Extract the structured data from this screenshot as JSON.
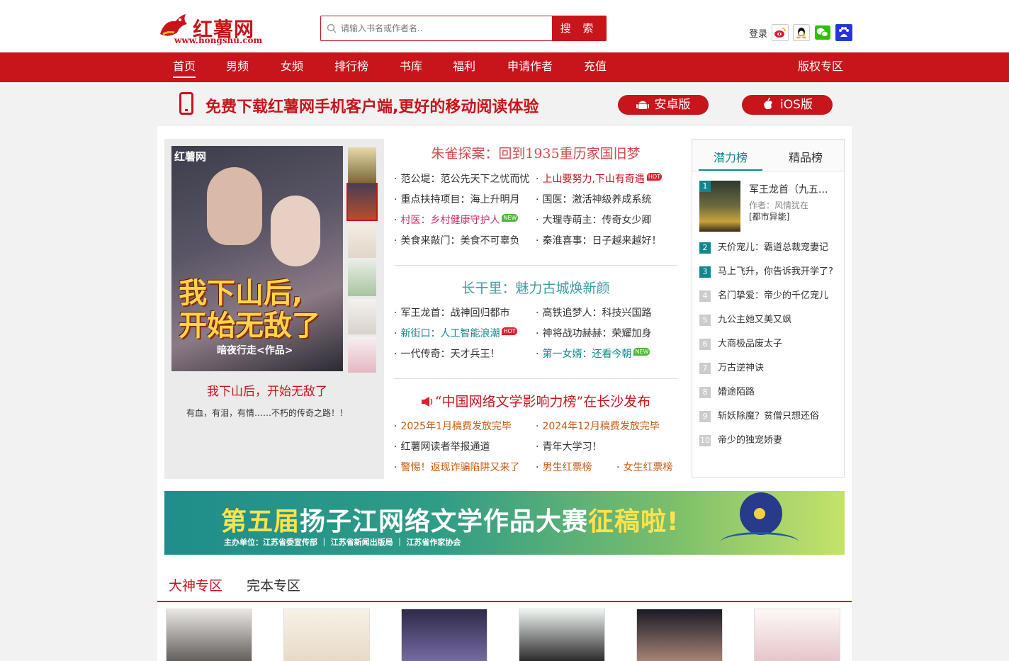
{
  "header": {
    "logo_name": "红薯网",
    "logo_url": "www.hongshu.com",
    "search_placeholder": "请输入书名或作者名..",
    "search_button": "搜 索",
    "login": "登录"
  },
  "nav": {
    "items": [
      "首页",
      "男频",
      "女频",
      "排行榜",
      "书库",
      "福利",
      "申请作者",
      "充值"
    ],
    "right": "版权专区"
  },
  "app_banner": {
    "message": "免费下载红薯网手机客户端,更好的移动阅读体验",
    "android": "安卓版",
    "ios": "iOS版"
  },
  "feature": {
    "cover_tag": "红薯网",
    "cover_title_line1": "我下山后,",
    "cover_title_line2": "开始无敌了",
    "cover_author": "暗夜行走<作品>",
    "title": "我下山后，开始无敌了",
    "desc": "有血，有泪，有情……不朽的传奇之路！！"
  },
  "section1": {
    "heading": "朱雀探案：回到1935重历家国旧梦",
    "items": [
      {
        "text": "范公堤：范公先天下之忧而忧",
        "style": ""
      },
      {
        "text": "上山要努力,下山有奇遇",
        "style": "red",
        "badge": "HOT"
      },
      {
        "text": "重点扶持项目：海上升明月",
        "style": ""
      },
      {
        "text": "国医：激活神级养成系统",
        "style": ""
      },
      {
        "text": "村医：乡村健康守护人",
        "style": "pink",
        "badge": "NEW"
      },
      {
        "text": "大理寺萌主：传奇女少卿",
        "style": ""
      },
      {
        "text": "美食来敲门：美食不可辜负",
        "style": ""
      },
      {
        "text": "秦淮喜事：日子越来越好！",
        "style": ""
      }
    ]
  },
  "section2": {
    "heading": "长干里：魅力古城焕新颜",
    "items": [
      {
        "text": "军王龙首：战神回归都市",
        "style": ""
      },
      {
        "text": "高铁追梦人：科技兴国路",
        "style": ""
      },
      {
        "text": "新街口：人工智能浪潮",
        "style": "teal",
        "badge": "HOT"
      },
      {
        "text": "神将战功赫赫：荣耀加身",
        "style": ""
      },
      {
        "text": "一代传奇：天才兵王！",
        "style": ""
      },
      {
        "text": "第一女婿：还看今朝",
        "style": "teal",
        "badge": "NEW"
      }
    ]
  },
  "section3": {
    "heading": "“中国网络文学影响力榜”在长沙发布",
    "items": [
      {
        "text": "2025年1月稿费发放完毕",
        "style": "orange"
      },
      {
        "text": "2024年12月稿费发放完毕",
        "style": "orange"
      },
      {
        "text": "红薯网读者举报通道",
        "style": ""
      },
      {
        "text": "青年大学习！",
        "style": ""
      },
      {
        "text": "警惕！返现诈骗陷阱又来了",
        "style": "orange"
      },
      {
        "text": "男生红票榜",
        "style": "orange"
      },
      {
        "text": "女生红票榜",
        "style": "orange"
      }
    ]
  },
  "rank": {
    "tabs": [
      "潜力榜",
      "精品榜"
    ],
    "first": {
      "num": "1",
      "title": "军王龙首（九五...",
      "author": "作者：风情犹在",
      "category": "[都市异能]"
    },
    "rows": [
      {
        "num": "2",
        "title": "天价宠儿：霸道总裁宠妻记"
      },
      {
        "num": "3",
        "title": "马上飞升，你告诉我开学了?"
      },
      {
        "num": "4",
        "title": "名门挚爱：帝少的千亿宠儿"
      },
      {
        "num": "5",
        "title": "九公主她又美又飒"
      },
      {
        "num": "6",
        "title": "大商极品废太子"
      },
      {
        "num": "7",
        "title": "万古逆神诀"
      },
      {
        "num": "8",
        "title": "婚途陌路"
      },
      {
        "num": "9",
        "title": "斩妖除魔？贫僧只想还俗"
      },
      {
        "num": "10",
        "title": "帝少的独宠娇妻"
      }
    ]
  },
  "ad": {
    "line_a": "第五届",
    "line_b": "扬子江网络文学作品大赛",
    "line_c": "征稿啦!",
    "sub": "主办单位：江苏省委宣传部 ｜ 江苏省新闻出版局 ｜ 江苏省作家协会"
  },
  "zones": {
    "active": "大神专区",
    "other": "完本专区"
  },
  "colors": {
    "brand": "#c8141b",
    "teal": "#13868f"
  }
}
